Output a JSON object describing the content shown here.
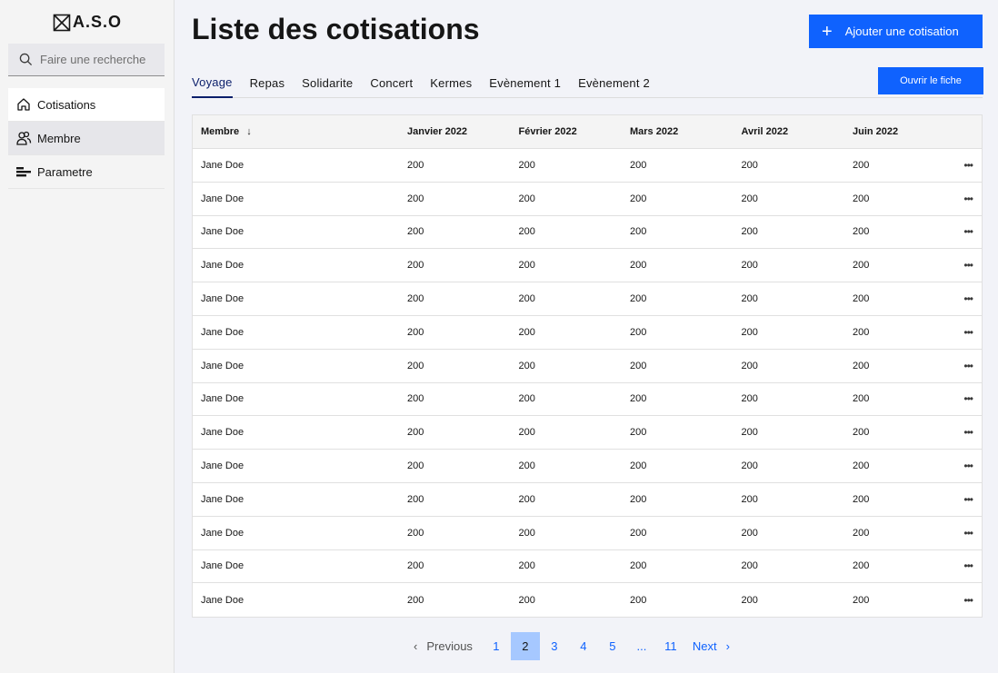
{
  "app": {
    "logo_text": "A.S.O"
  },
  "search": {
    "placeholder": "Faire une recherche"
  },
  "sidebar": {
    "items": [
      {
        "label": "Cotisations",
        "icon": "home-icon"
      },
      {
        "label": "Membre",
        "icon": "users-icon"
      },
      {
        "label": "Parametre",
        "icon": "settings-sliders-icon"
      }
    ]
  },
  "header": {
    "title": "Liste des cotisations",
    "add_button": "Ajouter une cotisation",
    "open_button": "Ouvrir le fiche"
  },
  "tabs": [
    "Voyage",
    "Repas",
    "Solidarite",
    "Concert",
    "Kermes",
    "Evènement 1",
    "Evènement 2"
  ],
  "active_tab": "Voyage",
  "table": {
    "columns": [
      "Membre",
      "Janvier 2022",
      "Février 2022",
      "Mars 2022",
      "Avril 2022",
      "Juin 2022"
    ],
    "rows": [
      [
        "Jane Doe",
        "200",
        "200",
        "200",
        "200",
        "200"
      ],
      [
        "Jane Doe",
        "200",
        "200",
        "200",
        "200",
        "200"
      ],
      [
        "Jane Doe",
        "200",
        "200",
        "200",
        "200",
        "200"
      ],
      [
        "Jane Doe",
        "200",
        "200",
        "200",
        "200",
        "200"
      ],
      [
        "Jane Doe",
        "200",
        "200",
        "200",
        "200",
        "200"
      ],
      [
        "Jane Doe",
        "200",
        "200",
        "200",
        "200",
        "200"
      ],
      [
        "Jane Doe",
        "200",
        "200",
        "200",
        "200",
        "200"
      ],
      [
        "Jane Doe",
        "200",
        "200",
        "200",
        "200",
        "200"
      ],
      [
        "Jane Doe",
        "200",
        "200",
        "200",
        "200",
        "200"
      ],
      [
        "Jane Doe",
        "200",
        "200",
        "200",
        "200",
        "200"
      ],
      [
        "Jane Doe",
        "200",
        "200",
        "200",
        "200",
        "200"
      ],
      [
        "Jane Doe",
        "200",
        "200",
        "200",
        "200",
        "200"
      ],
      [
        "Jane Doe",
        "200",
        "200",
        "200",
        "200",
        "200"
      ],
      [
        "Jane Doe",
        "200",
        "200",
        "200",
        "200",
        "200"
      ]
    ],
    "row_menu": "•••"
  },
  "pagination": {
    "previous": "Previous",
    "next": "Next",
    "pages": [
      "1",
      "2",
      "3",
      "4",
      "5",
      "...",
      "11"
    ],
    "current": "2"
  },
  "colors": {
    "primary": "#0f62fe",
    "active_tab": "#0b1f6b",
    "current_page": "#a6c8ff"
  }
}
